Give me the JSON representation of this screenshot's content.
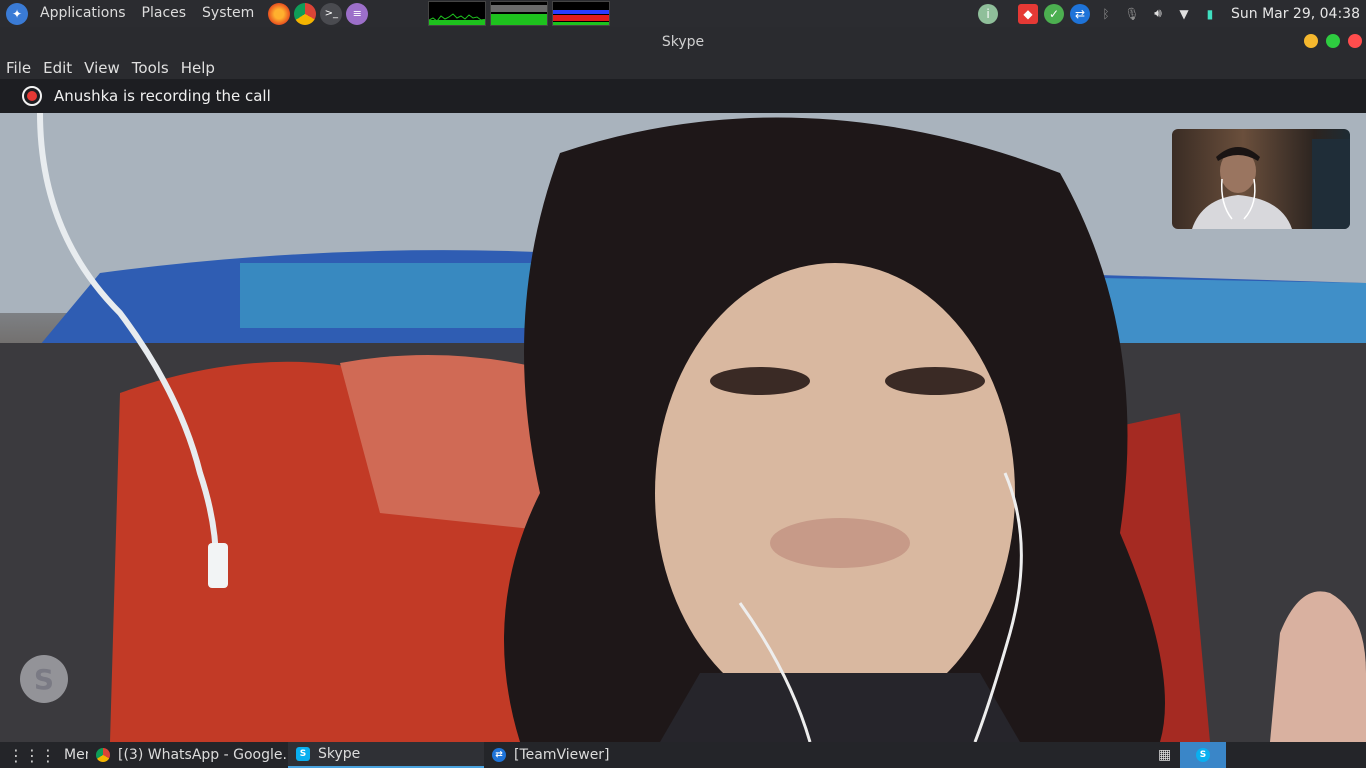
{
  "top_panel": {
    "menus": [
      "Applications",
      "Places",
      "System"
    ],
    "launchers": [
      "firefox-icon",
      "chrome-icon",
      "terminal-icon",
      "text-editor-icon"
    ],
    "tray_icons": [
      "updates-icon",
      "anydesk-icon",
      "check-icon",
      "teamviewer-icon",
      "bluetooth-icon",
      "microphone-icon",
      "volume-icon",
      "wifi-icon",
      "battery-icon"
    ],
    "clock": "Sun Mar 29, 04:38"
  },
  "window": {
    "title": "Skype"
  },
  "menubar": {
    "items": [
      "File",
      "Edit",
      "View",
      "Tools",
      "Help"
    ]
  },
  "recording": {
    "text": "Anushka is recording the call"
  },
  "taskbar": {
    "menu_label": "Menu",
    "tasks": [
      {
        "label": "[(3) WhatsApp - Google...",
        "icon": "chrome-icon"
      },
      {
        "label": "Skype",
        "icon": "skype-icon"
      },
      {
        "label": "[TeamViewer]",
        "icon": "teamviewer-icon"
      }
    ]
  },
  "colors": {
    "accent": "#4aa3df",
    "recording": "#e53935",
    "minimize": "#f5b82e",
    "maximize": "#2ecc40",
    "close": "#ff4d4d"
  }
}
